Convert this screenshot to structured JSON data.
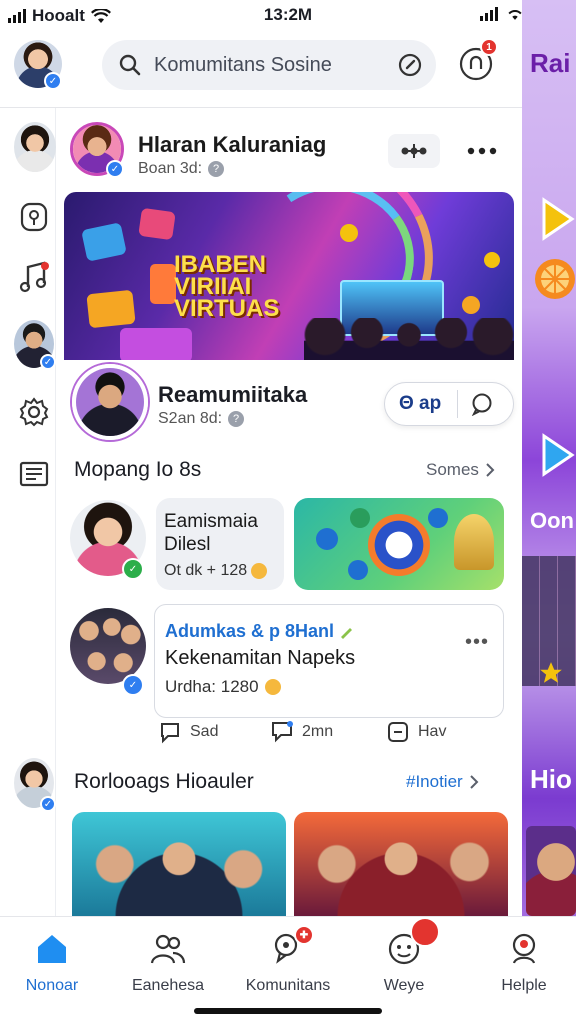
{
  "status_bar": {
    "carrier": "Hooalt",
    "time": "13:2M"
  },
  "header": {
    "search_placeholder": "Komumitans Sosine",
    "notification_count": "1"
  },
  "page": {
    "title": "Hlaran Kaluraniag",
    "subtitle": "Boan 3d:"
  },
  "banner": {
    "line1": "IBABEN",
    "line2": "VIRIIAI",
    "line3": "VIRTUAS"
  },
  "profile": {
    "name": "Reamumiitaka",
    "subtitle": "S2an 8d:",
    "pill_label": "Θ ap"
  },
  "section1": {
    "title": "Mopang Io 8s",
    "link": "Somes"
  },
  "feature_card": {
    "line1": "Eamismaia",
    "line2": "Dilesl",
    "meta": "Ot dk + 128"
  },
  "post": {
    "line1": "Adumkas & p 8Hanl",
    "line2": "Kekenamitan Napeks",
    "line3": "Urdha: 1280",
    "more": "•••"
  },
  "actions": {
    "a1": "Sad",
    "a2": "2mn",
    "a3": "Hav"
  },
  "section2": {
    "title": "Rorlooags Hioauler",
    "link": "#Inotier"
  },
  "peek": {
    "t1": "Rai",
    "t2": "Oon",
    "t3": "Hio"
  },
  "bottom_nav": [
    {
      "label": "Nonoar"
    },
    {
      "label": "Eanehesa"
    },
    {
      "label": "Komunitans"
    },
    {
      "label": "Weye"
    },
    {
      "label": "Helple"
    }
  ],
  "colors": {
    "accent": "#1f6fd1",
    "badge": "#e3342f",
    "verified": "#2f7ef0",
    "online": "#2cae4a"
  }
}
